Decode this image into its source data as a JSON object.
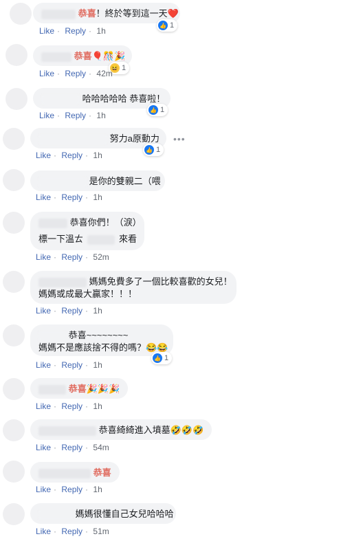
{
  "comments": [
    {
      "tag": "恭喜",
      "text": "！終於等到這一天❤️",
      "reaction": "1",
      "time": "1h"
    },
    {
      "tag": "恭喜",
      "text": "🎈🎊🎉",
      "reaction": "1",
      "time": "42m"
    },
    {
      "text": "哈哈哈哈哈 恭喜啦！",
      "reaction": "1",
      "time": "1h"
    },
    {
      "text": "努力a原動力",
      "reaction": "1",
      "time": "1h"
    },
    {
      "text": "是你的雙親二（喂",
      "time": "1h"
    },
    {
      "text": "恭喜你們！（淚）",
      "text2": "標一下溫ㄊ",
      "text2b": "來看",
      "time": "52m"
    },
    {
      "text": "媽媽免費多了一個比較喜歡的女兒！",
      "text2": "媽媽或成最大贏家！！！",
      "time": "1h"
    },
    {
      "text": "恭喜~~~~~~~~",
      "text2": "媽媽不是應該捨不得的嗎？😂😂",
      "reaction": "1",
      "time": "1h"
    },
    {
      "tag": "恭喜",
      "text": "🎉🎉🎉",
      "time": "1h"
    },
    {
      "text": "恭喜綺綺進入墳墓🤣🤣🤣",
      "time": "54m"
    },
    {
      "tag": "恭喜",
      "time": "1h"
    },
    {
      "text": "媽媽很懂自己女兒哈哈哈",
      "time": "51m"
    }
  ],
  "actions": {
    "like": "Like",
    "reply": "Reply",
    "dot": "·"
  },
  "more_label": "•••"
}
